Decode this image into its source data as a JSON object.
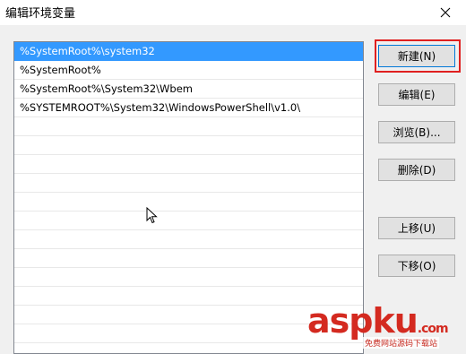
{
  "window": {
    "title": "编辑环境变量"
  },
  "list": {
    "items": [
      "%SystemRoot%\\system32",
      "%SystemRoot%",
      "%SystemRoot%\\System32\\Wbem",
      "%SYSTEMROOT%\\System32\\WindowsPowerShell\\v1.0\\",
      "",
      "",
      "",
      "",
      "",
      "",
      "",
      "",
      "",
      "",
      "",
      ""
    ],
    "selected_index": 0
  },
  "buttons": {
    "new": "新建(N)",
    "edit": "编辑(E)",
    "browse": "浏览(B)...",
    "delete": "删除(D)",
    "move_up": "上移(U)",
    "move_down": "下移(O)"
  },
  "watermark": {
    "main": "aspku",
    "suffix": ".com",
    "sub": "免费网站源码下载站"
  },
  "colors": {
    "selection": "#3399ff",
    "highlight": "#e02020",
    "watermark": "#d42a20"
  }
}
